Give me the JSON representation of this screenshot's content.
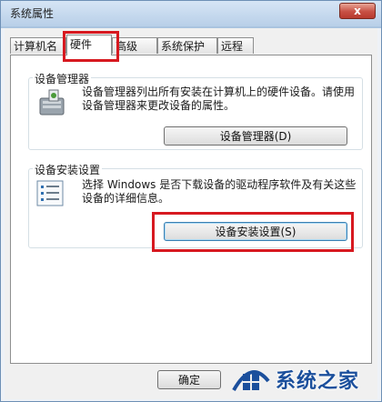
{
  "window": {
    "title": "系统属性",
    "close_label": "x"
  },
  "tabs": [
    {
      "label": "计算机名"
    },
    {
      "label": "硬件"
    },
    {
      "label": "高级"
    },
    {
      "label": "系统保护"
    },
    {
      "label": "远程"
    }
  ],
  "device_manager": {
    "title": "设备管理器",
    "description": "设备管理器列出所有安装在计算机上的硬件设备。请使用设备管理器来更改设备的属性。",
    "button_label": "设备管理器(D)"
  },
  "device_install": {
    "title": "设备安装设置",
    "description": "选择 Windows 是否下载设备的驱动程序软件及有关这些设备的详细信息。",
    "button_label": "设备安装设置(S)"
  },
  "footer": {
    "ok_label": "确定"
  },
  "watermark": {
    "text": "系统之家"
  },
  "colors": {
    "highlight": "#d71920",
    "watermark": "#1b4f9c"
  }
}
